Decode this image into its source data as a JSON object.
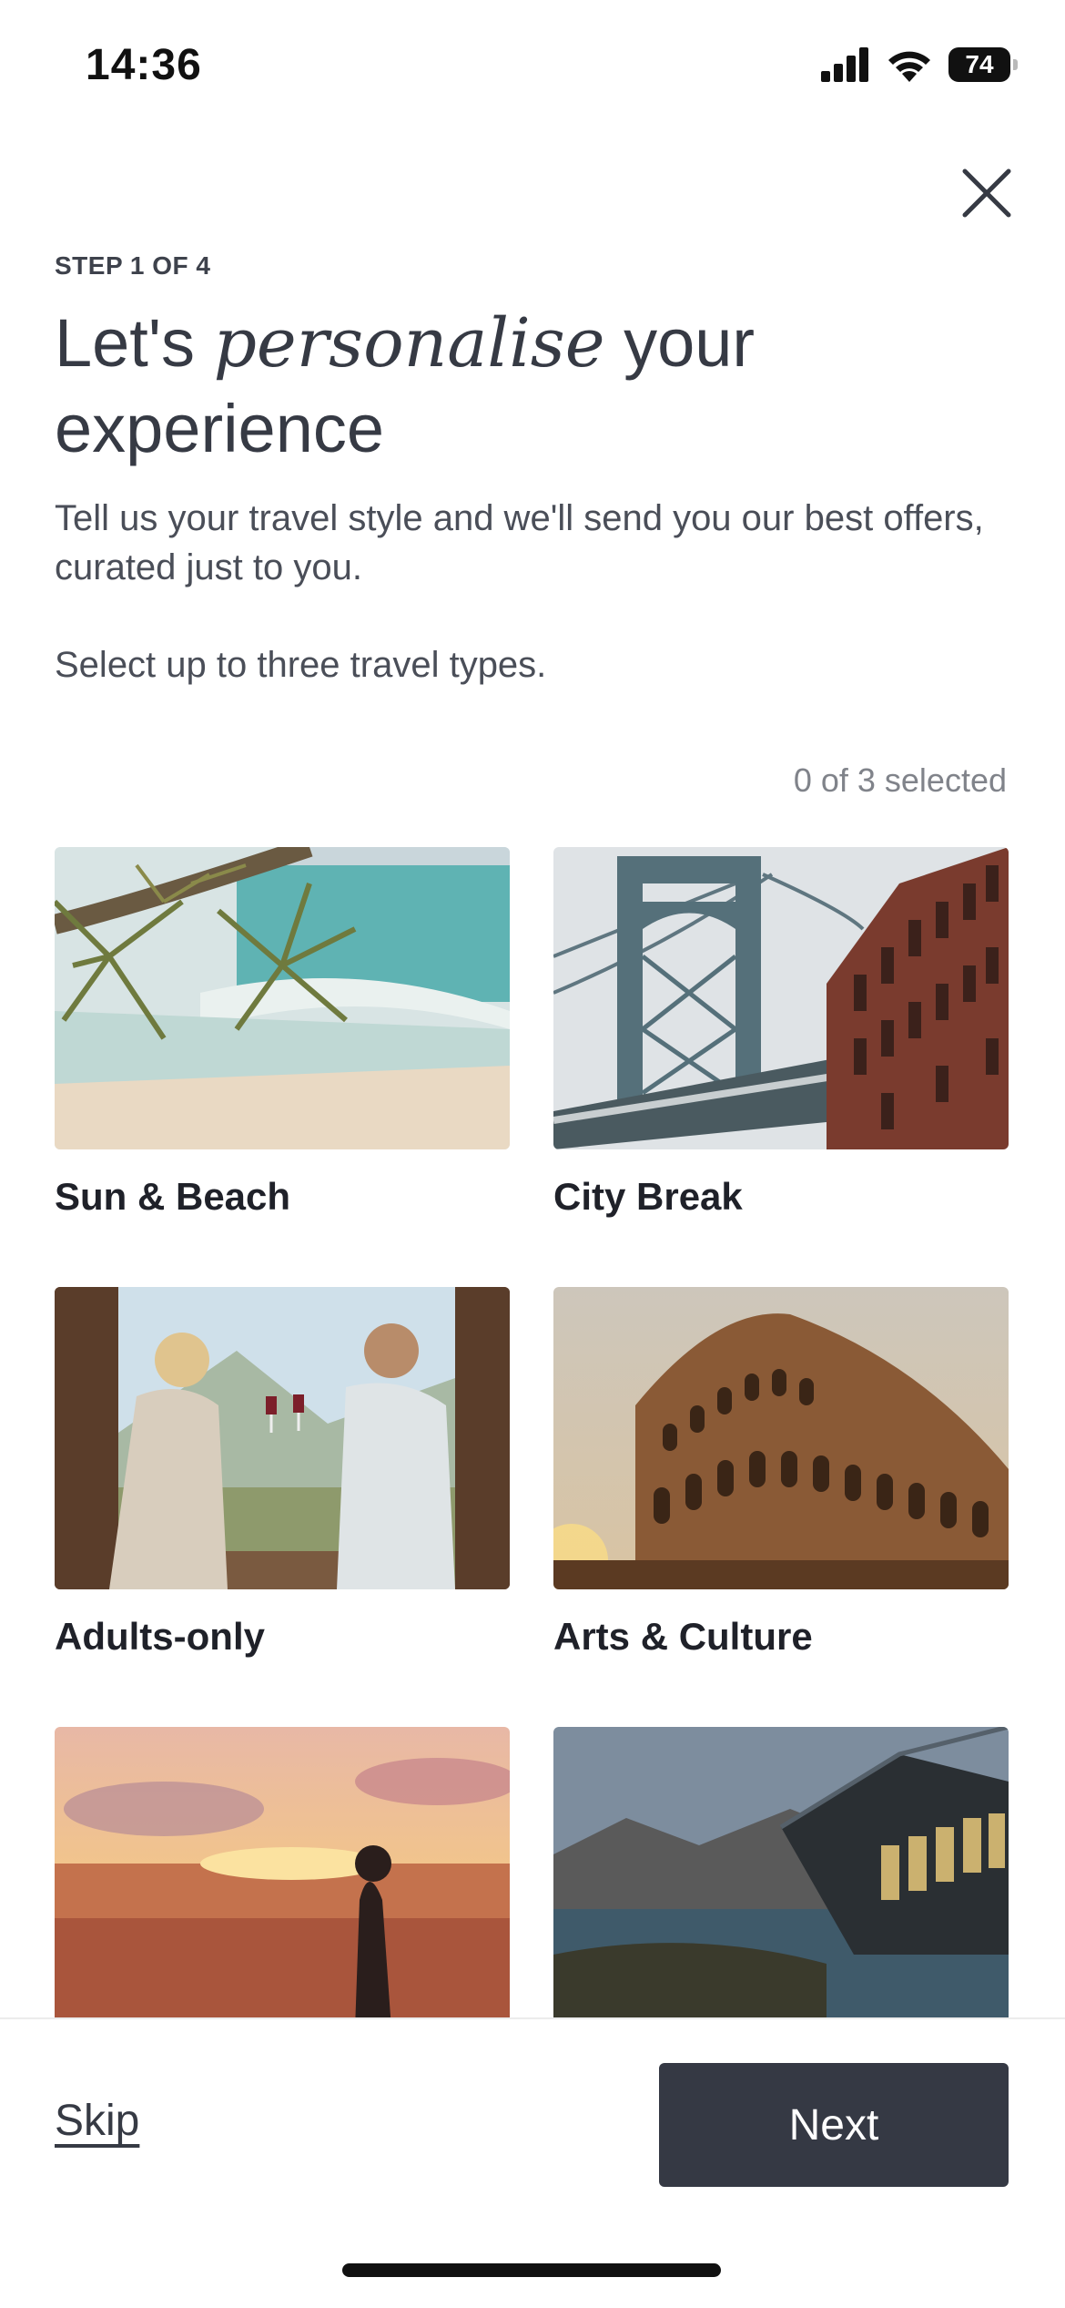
{
  "status_bar": {
    "time": "14:36",
    "battery": "74"
  },
  "header": {
    "step": "STEP 1 OF 4",
    "title_prefix": "Let's ",
    "title_emphasis": "personalise",
    "title_suffix": " your experience",
    "description": "Tell us your travel style and we'll send you our best offers, curated just to you.",
    "instruction": "Select up to three travel types."
  },
  "selection": {
    "counter": "0 of 3 selected",
    "selected_count": 0,
    "max": 3
  },
  "travel_types": [
    {
      "label": "Sun & Beach"
    },
    {
      "label": "City Break"
    },
    {
      "label": "Adults-only"
    },
    {
      "label": "Arts & Culture"
    },
    {
      "label": ""
    },
    {
      "label": ""
    }
  ],
  "footer": {
    "skip_label": "Skip",
    "next_label": "Next"
  },
  "colors": {
    "primary_button": "#353944",
    "text": "#363a44",
    "muted": "#80838a"
  }
}
